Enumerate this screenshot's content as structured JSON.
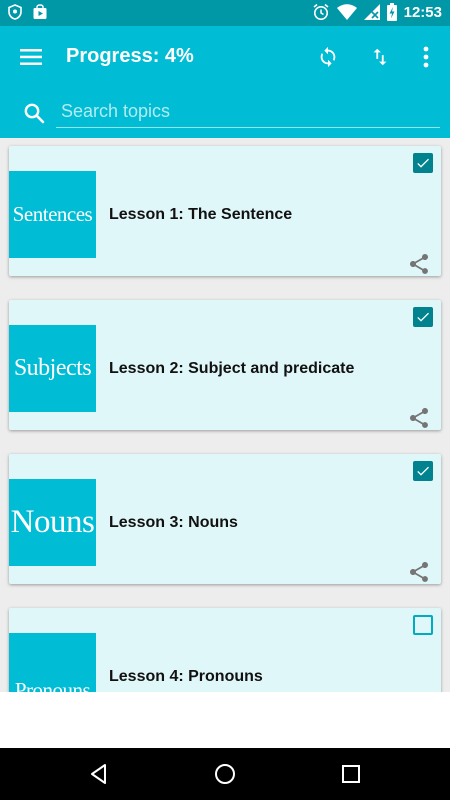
{
  "status_bar": {
    "time": "12:53",
    "left_icons": [
      "shield-icon",
      "play-store-bag-icon"
    ],
    "right_icons": [
      "alarm-icon",
      "wifi-icon",
      "cellular-no-signal-icon",
      "battery-charging-icon"
    ]
  },
  "app_bar": {
    "title": "Progress: 4%",
    "progress_percent": 4,
    "actions": [
      "sync-icon",
      "sort-icon",
      "more-vert-icon"
    ]
  },
  "search": {
    "placeholder": "Search topics",
    "value": ""
  },
  "lessons": [
    {
      "title": "Lesson 1: The Sentence",
      "thumb_text": "Sentences",
      "completed": true
    },
    {
      "title": "Lesson 2: Subject and predicate",
      "thumb_text": "Subjects",
      "completed": true
    },
    {
      "title": "Lesson 3: Nouns",
      "thumb_text": "Nouns",
      "completed": true
    },
    {
      "title": "Lesson 4: Pronouns",
      "thumb_text": "Pronouns",
      "completed": false
    }
  ],
  "nav_bar": {
    "buttons": [
      "back-icon",
      "home-icon",
      "recents-icon"
    ]
  },
  "colors": {
    "status_bar": "#0097a7",
    "primary": "#00bcd4",
    "card_bg": "#e0f7fa",
    "checkbox": "#00838f",
    "list_bg": "#ededed"
  }
}
